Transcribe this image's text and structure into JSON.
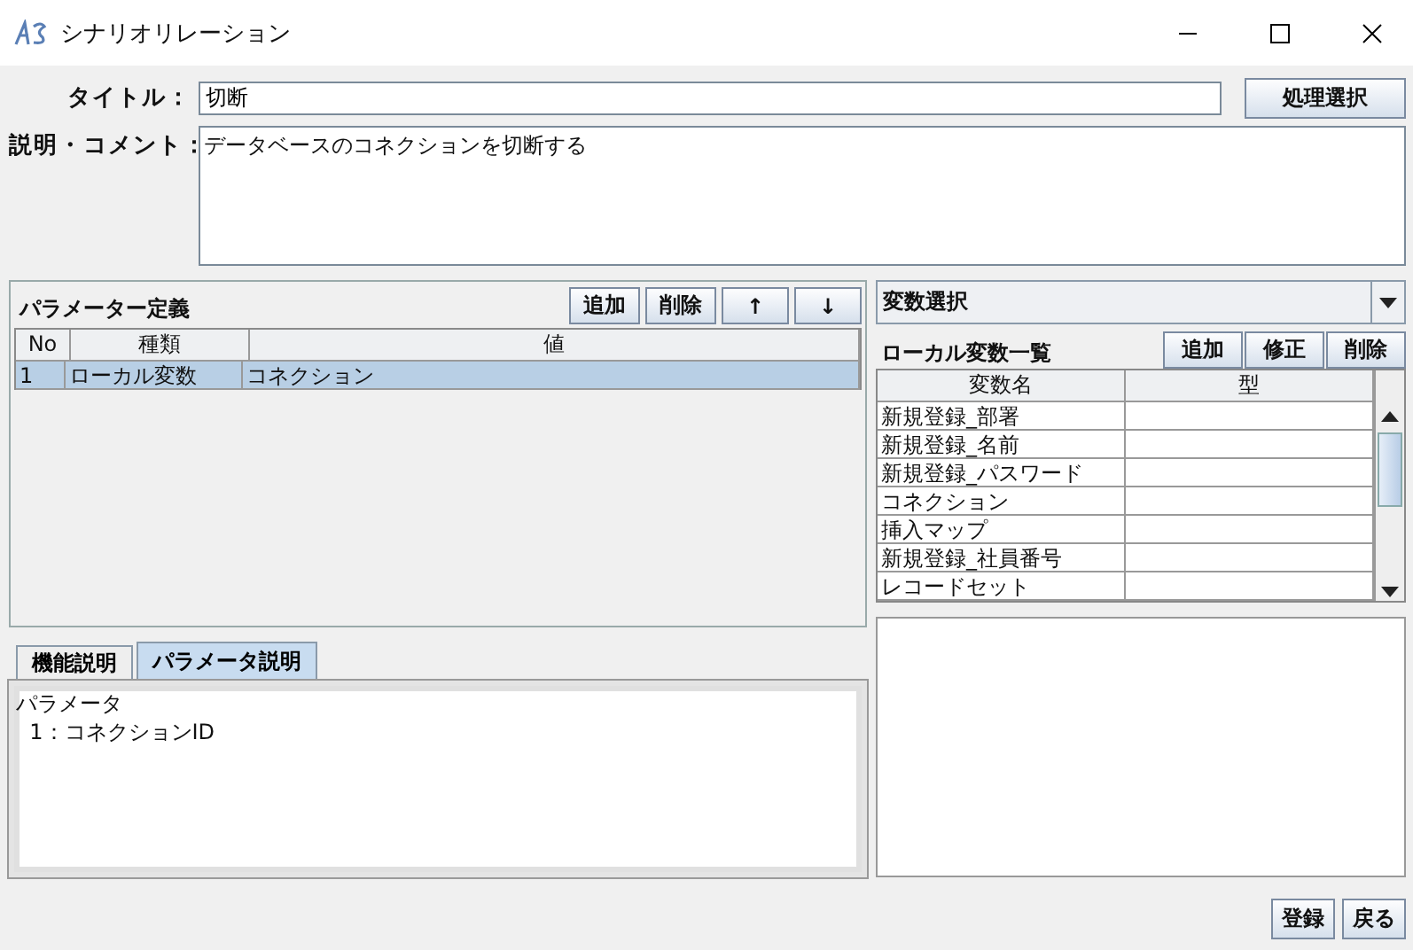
{
  "window": {
    "title": "シナリオリレーション"
  },
  "form": {
    "title_label": "タイトル：",
    "title_value": "切断",
    "comment_label": "説明・コメント：",
    "comment_value": "データベースのコネクションを切断する",
    "select_button": "処理選択"
  },
  "parameters": {
    "heading": "パラメーター定義",
    "buttons": [
      "追加",
      "削除",
      "↑",
      "↓"
    ],
    "columns": [
      "No",
      "種類",
      "値"
    ],
    "rows": [
      {
        "cells": [
          "1",
          "ローカル変数",
          "コネクション"
        ],
        "selected": true
      }
    ]
  },
  "variable_select": {
    "value": "変数選択"
  },
  "local_variables": {
    "heading": "ローカル変数一覧",
    "buttons": [
      "追加",
      "修正",
      "削除"
    ],
    "columns": [
      "変数名",
      "型"
    ],
    "rows": [
      {
        "cells": [
          "新規登録_部署",
          ""
        ]
      },
      {
        "cells": [
          "新規登録_名前",
          ""
        ]
      },
      {
        "cells": [
          "新規登録_パスワード",
          ""
        ]
      },
      {
        "cells": [
          "コネクション",
          ""
        ]
      },
      {
        "cells": [
          "挿入マップ",
          ""
        ]
      },
      {
        "cells": [
          "新規登録_社員番号",
          ""
        ]
      },
      {
        "cells": [
          "レコードセット",
          ""
        ]
      }
    ]
  },
  "description_tabs": [
    {
      "label": "機能説明",
      "selected": false
    },
    {
      "label": "パラメータ説明",
      "selected": true
    }
  ],
  "description_lines": [
    "パラメータ",
    "  1：コネクションID"
  ],
  "footer_buttons": [
    "登録",
    "戻る"
  ]
}
